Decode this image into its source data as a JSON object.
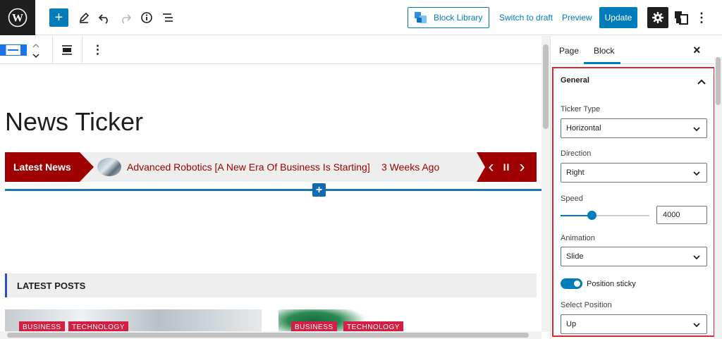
{
  "topbar": {
    "block_library_label": "Block Library",
    "switch_to_draft_label": "Switch to draft",
    "preview_label": "Preview",
    "update_label": "Update",
    "logo_text": "W",
    "add_text": "+",
    "more_text": "⋮"
  },
  "block_toolbar": {
    "more_text": "⋮"
  },
  "canvas": {
    "page_title": "News Ticker",
    "ticker": {
      "label": "Latest News",
      "headline": "Advanced Robotics [A New Era Of Business Is Starting]",
      "time": "3 Weeks Ago",
      "prev_text": "‹",
      "pause_text": "II",
      "next_text": "›"
    },
    "inserter_text": "+",
    "posts_header": "LATEST POSTS",
    "posts": [
      {
        "tags": [
          "BUSINESS",
          "TECHNOLOGY"
        ]
      },
      {
        "tags": [
          "BUSINESS",
          "TECHNOLOGY"
        ]
      }
    ]
  },
  "sidebar": {
    "tabs": [
      "Page",
      "Block"
    ],
    "active_tab": "Block",
    "close_text": "×",
    "panel": {
      "title": "General",
      "ticker_type": {
        "label": "Ticker Type",
        "value": "Horizontal"
      },
      "direction": {
        "label": "Direction",
        "value": "Right"
      },
      "speed": {
        "label": "Speed",
        "value": "4000"
      },
      "animation": {
        "label": "Animation",
        "value": "Slide"
      },
      "position_sticky": {
        "label": "Position sticky",
        "checked": true
      },
      "select_position": {
        "label": "Select Position",
        "value": "Up"
      }
    }
  },
  "colors": {
    "accent": "#007cba",
    "ticker_red": "#9e0000",
    "tag_red": "#d41e43",
    "panel_border": "#e2282f"
  }
}
